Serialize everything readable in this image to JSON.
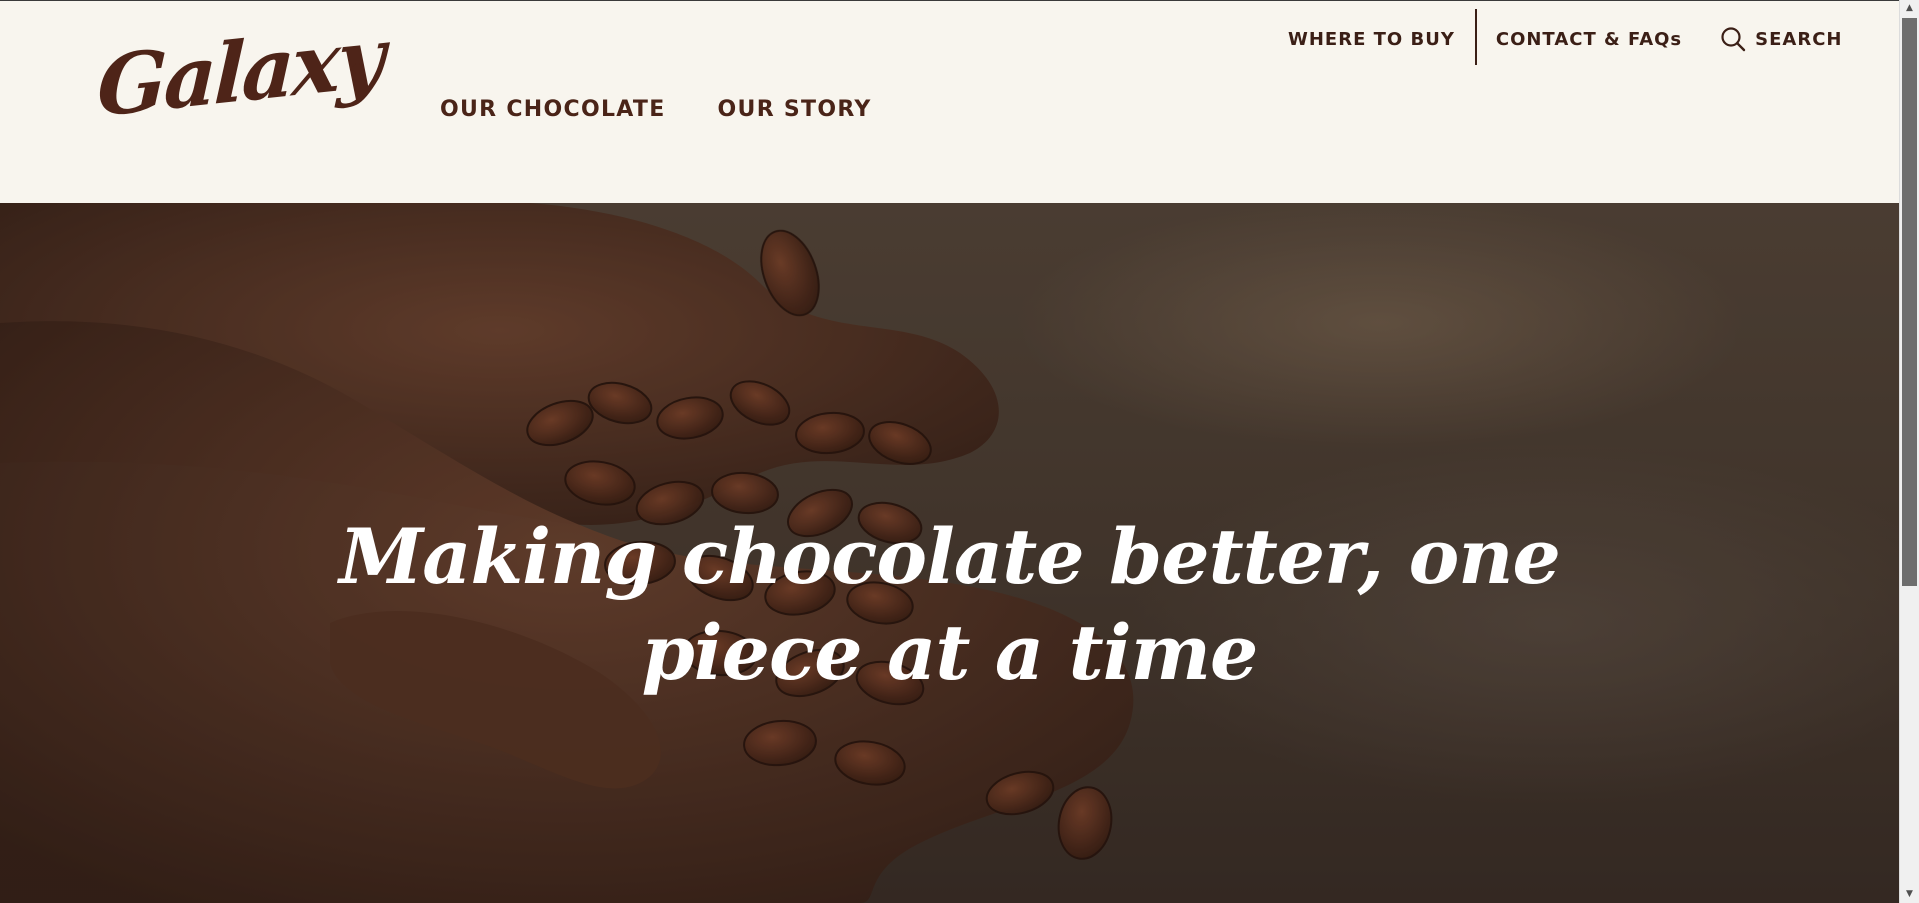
{
  "brand": {
    "logo_text": "Galaxy",
    "color": "#4e2418"
  },
  "utility_nav": {
    "where_to_buy": "WHERE TO BUY",
    "contact": "CONTACT & FAQs",
    "search": "SEARCH"
  },
  "main_nav": [
    {
      "label": "OUR CHOCOLATE"
    },
    {
      "label": "OUR STORY"
    }
  ],
  "hero": {
    "title_line_1": "Making chocolate better, one",
    "title_line_2": "piece at a time"
  },
  "colors": {
    "header_bg": "#f8f5ee",
    "nav_text": "#4a2418",
    "hero_text": "#ffffff"
  },
  "icons": {
    "search": "search-icon",
    "scroll_up": "scroll-up-arrow-icon",
    "scroll_down": "scroll-down-arrow-icon"
  }
}
